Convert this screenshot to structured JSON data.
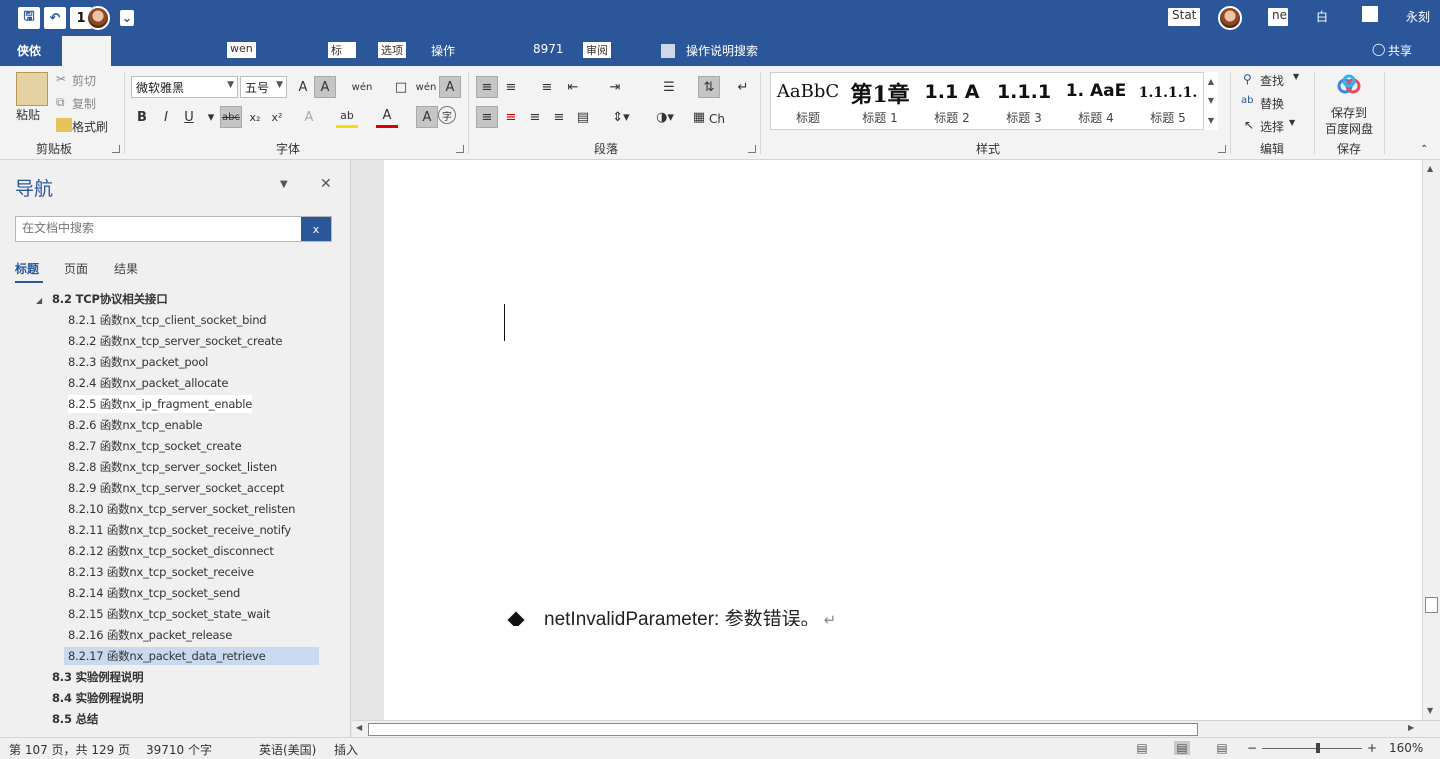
{
  "titlebar": {
    "save_icon": "save-icon",
    "undo_label": "↶",
    "qa_box": "1",
    "dropdown": "⌄",
    "title_blur": "Stat",
    "title_blur2": "ne",
    "window_btn1": "白",
    "window_btn2": "永刻"
  },
  "tabs": {
    "file": "侠侬",
    "t1": "wen",
    "t2": "标",
    "t3": "选项",
    "t4": "操作",
    "t5": "8971",
    "t6": "审阅",
    "search_help": "操作说明搜索",
    "share": "共享"
  },
  "ribbon": {
    "clipboard": {
      "paste": "粘贴",
      "cut": "剪切",
      "copy": "复制",
      "format_painter": "格式刷",
      "label": "剪贴板"
    },
    "font": {
      "font_name": "微软雅黑",
      "font_size": "五号",
      "label": "字体",
      "bold": "B",
      "italic": "I",
      "underline": "U",
      "strike": "abc",
      "subscript": "x₂",
      "superscript": "x²",
      "grow": "A",
      "clear": "A",
      "wen": "wén",
      "char": "A",
      "highlight": "ab",
      "color": "A",
      "shade": "A",
      "circle": "字"
    },
    "paragraph": {
      "label": "段落",
      "show_marks": "↵",
      "ch": "Ch"
    },
    "styles": {
      "label": "样式",
      "items": [
        {
          "sample": "AaBbC",
          "name": "标题"
        },
        {
          "sample": "第1章",
          "name": "标题 1"
        },
        {
          "sample": "1.1  A",
          "name": "标题 2"
        },
        {
          "sample": "1.1.1",
          "name": "标题 3"
        },
        {
          "sample": "1.  AaE",
          "name": "标题 4"
        },
        {
          "sample": "1.1.1.1.",
          "name": "标题 5"
        }
      ]
    },
    "editing": {
      "find": "查找",
      "replace": "替换",
      "select": "选择",
      "label": "编辑"
    },
    "save": {
      "save_to_1": "保存到",
      "save_to_2": "百度网盘",
      "label": "保存"
    }
  },
  "nav": {
    "title": "导航",
    "search_placeholder": "在文档中搜索",
    "search_btn": "x",
    "tabs": [
      "标题",
      "页面",
      "结果"
    ],
    "items": [
      {
        "text": "8.2 TCP协议相关接口",
        "level": 1
      },
      {
        "text": "8.2.1 函数nx_tcp_client_socket_bind",
        "level": 2
      },
      {
        "text": "8.2.2 函数nx_tcp_server_socket_create",
        "level": 2
      },
      {
        "text": "8.2.3 函数nx_packet_pool",
        "level": 2
      },
      {
        "text": "8.2.4 函数nx_packet_allocate",
        "level": 2
      },
      {
        "text": "8.2.5 函数nx_ip_fragment_enable",
        "level": 2,
        "highlight": true
      },
      {
        "text": "8.2.6 函数nx_tcp_enable",
        "level": 2
      },
      {
        "text": "8.2.7 函数nx_tcp_socket_create",
        "level": 2
      },
      {
        "text": "8.2.8 函数nx_tcp_server_socket_listen",
        "level": 2
      },
      {
        "text": "8.2.9 函数nx_tcp_server_socket_accept",
        "level": 2
      },
      {
        "text": "8.2.10 函数nx_tcp_server_socket_relisten",
        "level": 2
      },
      {
        "text": "8.2.11 函数nx_tcp_socket_receive_notify",
        "level": 2
      },
      {
        "text": "8.2.12 函数nx_tcp_socket_disconnect",
        "level": 2
      },
      {
        "text": "8.2.13 函数nx_tcp_socket_receive",
        "level": 2
      },
      {
        "text": "8.2.14 函数nx_tcp_socket_send",
        "level": 2
      },
      {
        "text": "8.2.15 函数nx_tcp_socket_state_wait",
        "level": 2
      },
      {
        "text": "8.2.16 函数nx_packet_release",
        "level": 2
      },
      {
        "text": "8.2.17 函数nx_packet_data_retrieve",
        "level": 2,
        "selected": true
      },
      {
        "text": "8.3 实验例程说明",
        "level": 1
      },
      {
        "text": "8.4 实验例程说明",
        "level": 1
      },
      {
        "text": "8.5 总结",
        "level": 1
      }
    ]
  },
  "document": {
    "bullet_text": "netInvalidParameter: 参数错误。",
    "para_mark": "↵"
  },
  "statusbar": {
    "page": "第 107 页，共 129 页",
    "words": "39710 个字",
    "language": "英语(美国)",
    "mode": "插入",
    "zoom_minus": "−",
    "zoom_plus": "+",
    "zoom": "160%"
  }
}
